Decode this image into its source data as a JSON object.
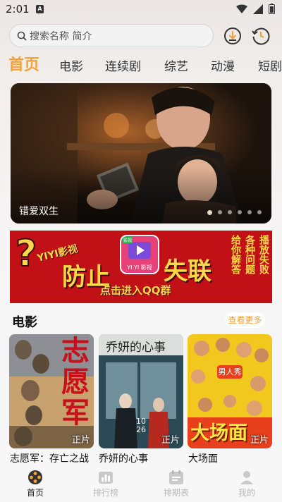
{
  "status_bar": {
    "time": "2:01",
    "notification_letter": "A"
  },
  "search": {
    "placeholder": "搜索名称 简介"
  },
  "tabs": [
    {
      "label": "首页",
      "active": true
    },
    {
      "label": "电影"
    },
    {
      "label": "连续剧"
    },
    {
      "label": "综艺"
    },
    {
      "label": "动漫"
    },
    {
      "label": "短剧"
    }
  ],
  "hero": {
    "title": "错爱双生",
    "page_count": 6,
    "active_index": 0
  },
  "ad": {
    "brand": "YIYI影视",
    "headline_left": "防止",
    "headline_right": "失联",
    "cta": "点击进入QQ群",
    "logo_text": "YI YI 影视",
    "logo_badge": "影视",
    "side_text_columns": [
      "给你解答",
      "各种问题",
      "播放失败"
    ]
  },
  "section": {
    "title": "电影",
    "more_label": "查看更多"
  },
  "movies": [
    {
      "title": "志愿军：存亡之战",
      "badge": "正片",
      "poster_text": "志愿军"
    },
    {
      "title": "乔妍的心事",
      "badge": "正片",
      "poster_text": "乔妍的心事",
      "poster_date": "10 26"
    },
    {
      "title": "大场面",
      "badge": "正片",
      "poster_text": "大场面",
      "poster_tag": "男人秀"
    }
  ],
  "bottom_nav": [
    {
      "label": "首页",
      "active": true
    },
    {
      "label": "排行榜"
    },
    {
      "label": "排期表"
    },
    {
      "label": "我的"
    }
  ],
  "colors": {
    "accent": "#f5a23a",
    "ad_red": "#c21017",
    "ad_yellow": "#ffd84a"
  }
}
